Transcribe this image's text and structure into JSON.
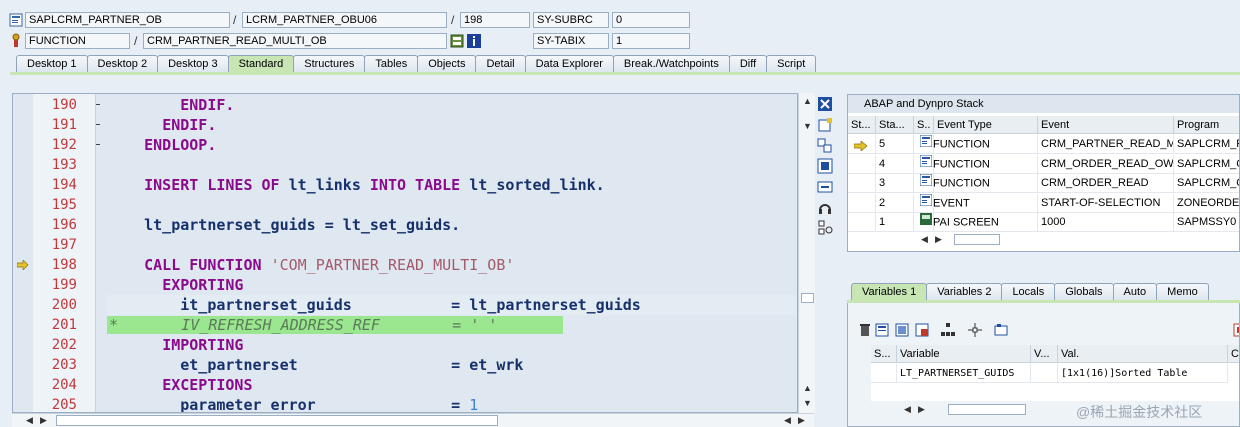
{
  "header": {
    "program": "SAPLCRM_PARTNER_OB",
    "include": "LCRM_PARTNER_OBU06",
    "line": "198",
    "subrc_label": "SY-SUBRC",
    "subrc_value": "0",
    "event_type": "FUNCTION",
    "event": "CRM_PARTNER_READ_MULTI_OB",
    "tabix_label": "SY-TABIX",
    "tabix_value": "1",
    "slash": "/"
  },
  "tabs": [
    "Desktop 1",
    "Desktop 2",
    "Desktop 3",
    "Standard",
    "Structures",
    "Tables",
    "Objects",
    "Detail",
    "Data Explorer",
    "Break./Watchpoints",
    "Diff",
    "Script"
  ],
  "active_tab": "Standard",
  "editor": {
    "lines": [
      {
        "n": "190",
        "segs": [
          {
            "t": "        ",
            "c": ""
          },
          {
            "t": "ENDIF.",
            "c": "kw"
          }
        ]
      },
      {
        "n": "191",
        "segs": [
          {
            "t": "      ",
            "c": ""
          },
          {
            "t": "ENDIF.",
            "c": "kw"
          }
        ]
      },
      {
        "n": "192",
        "segs": [
          {
            "t": "    ",
            "c": ""
          },
          {
            "t": "ENDLOOP.",
            "c": "kw"
          }
        ]
      },
      {
        "n": "193",
        "segs": []
      },
      {
        "n": "194",
        "segs": [
          {
            "t": "    ",
            "c": ""
          },
          {
            "t": "INSERT LINES OF ",
            "c": "kw"
          },
          {
            "t": "lt_links ",
            "c": "id"
          },
          {
            "t": "INTO TABLE ",
            "c": "kw"
          },
          {
            "t": "lt_sorted_link.",
            "c": "id"
          }
        ]
      },
      {
        "n": "195",
        "segs": []
      },
      {
        "n": "196",
        "segs": [
          {
            "t": "    ",
            "c": ""
          },
          {
            "t": "lt_partnerset_guids = lt_set_guids.",
            "c": "id"
          }
        ]
      },
      {
        "n": "197",
        "segs": []
      },
      {
        "n": "198",
        "segs": [
          {
            "t": "    ",
            "c": ""
          },
          {
            "t": "CALL FUNCTION ",
            "c": "kw"
          },
          {
            "t": "'COM_PARTNER_READ_MULTI_OB'",
            "c": "str"
          }
        ]
      },
      {
        "n": "199",
        "segs": [
          {
            "t": "      ",
            "c": ""
          },
          {
            "t": "EXPORTING",
            "c": "kw"
          }
        ]
      },
      {
        "n": "200",
        "segs": [
          {
            "t": "        ",
            "c": ""
          },
          {
            "t": "it_partnerset_guids           = lt_partnerset_guids",
            "c": "id"
          }
        ]
      },
      {
        "n": "201",
        "segs": [
          {
            "t": "*       IV_REFRESH_ADDRESS_REF        = ' '",
            "c": "cmt"
          }
        ]
      },
      {
        "n": "202",
        "segs": [
          {
            "t": "      ",
            "c": ""
          },
          {
            "t": "IMPORTING",
            "c": "kw"
          }
        ]
      },
      {
        "n": "203",
        "segs": [
          {
            "t": "        ",
            "c": ""
          },
          {
            "t": "et_partnerset                 = et_wrk",
            "c": "id"
          }
        ]
      },
      {
        "n": "204",
        "segs": [
          {
            "t": "      ",
            "c": ""
          },
          {
            "t": "EXCEPTIONS",
            "c": "kw"
          }
        ]
      },
      {
        "n": "205",
        "segs": [
          {
            "t": "        ",
            "c": ""
          },
          {
            "t": "parameter_error               = ",
            "c": "id"
          },
          {
            "t": "1",
            "c": "num"
          }
        ]
      }
    ],
    "current_line": "198"
  },
  "stack": {
    "title": "ABAP and Dynpro Stack",
    "columns": [
      "St...",
      "Sta...",
      "S..",
      "Event Type",
      "Event",
      "Program"
    ],
    "rows": [
      {
        "level": "5",
        "type": "FUNCTION",
        "event": "CRM_PARTNER_READ_M...",
        "program": "SAPLCRM_PA",
        "current": true
      },
      {
        "level": "4",
        "type": "FUNCTION",
        "event": "CRM_ORDER_READ_OW",
        "program": "SAPLCRM_OI",
        "current": false
      },
      {
        "level": "3",
        "type": "FUNCTION",
        "event": "CRM_ORDER_READ",
        "program": "SAPLCRM_OI",
        "current": false
      },
      {
        "level": "2",
        "type": "EVENT",
        "event": "START-OF-SELECTION",
        "program": "ZONEORDER",
        "current": false
      },
      {
        "level": "1",
        "type": "PAI SCREEN",
        "event": "1000",
        "program": "SAPMSSY0",
        "current": false
      }
    ]
  },
  "var_tabs": [
    "Variables 1",
    "Variables 2",
    "Locals",
    "Globals",
    "Auto",
    "Memo"
  ],
  "variables": {
    "columns": [
      "S...",
      "Variable",
      "V...",
      "Val.",
      "C."
    ],
    "rows": [
      {
        "name": "LT_PARTNERSET_GUIDS",
        "value": "[1x1(16)]Sorted Table"
      }
    ]
  },
  "watermark": "@稀土掘金技术社区",
  "colors": {
    "active_tab": "#c7e6b4",
    "keyword": "#8b0a8b",
    "identifier": "#16306b",
    "comment_bg": "#9be78f"
  }
}
